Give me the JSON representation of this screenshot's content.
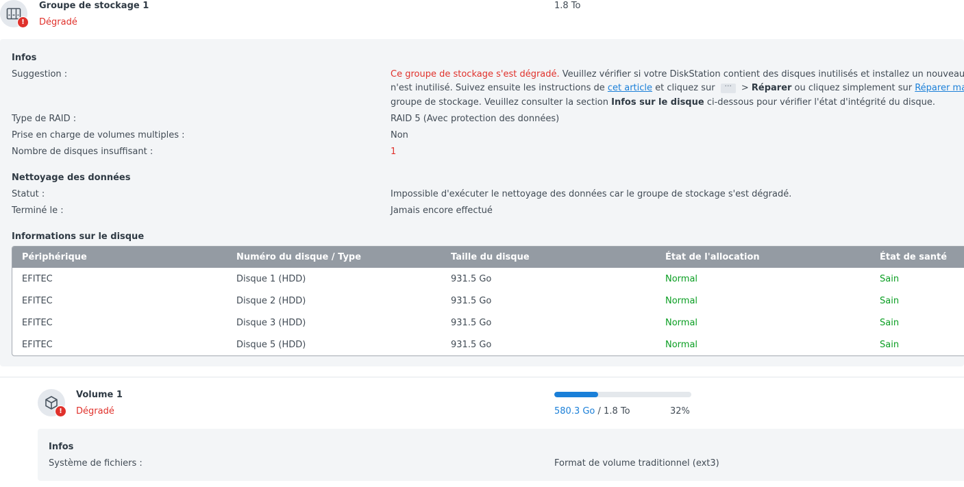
{
  "pool": {
    "name": "Groupe de stockage 1",
    "status": "Dégradé",
    "capacity": "1.8 To",
    "icon": "storage-pool-icon",
    "alert_icon": "alert-icon",
    "alert_symbol": "!"
  },
  "info": {
    "title": "Infos",
    "suggestion_label": "Suggestion :",
    "suggestion": {
      "red_part": "Ce groupe de stockage s'est dégradé.",
      "line1_rest": " Veuillez vérifier si votre DiskStation contient des disques inutilisés et installez un nouveau",
      "line2_a": "n'est inutilisé. Suivez ensuite les instructions de ",
      "link_article": "cet article",
      "line2_b": " et cliquez sur ",
      "more_glyph": "···",
      "line2_c": " > ",
      "repair_bold": "Réparer",
      "line2_d": " ou cliquez simplement sur ",
      "link_repair": "Réparer ma",
      "line3_a": "groupe de stockage. Veuillez consulter la section ",
      "disk_info_bold": "Infos sur le disque",
      "line3_b": " ci-dessous pour vérifier l'état d'intégrité du disque."
    },
    "raid_label": "Type de RAID :",
    "raid_value": "RAID 5 (Avec protection des données)",
    "multi_label": "Prise en charge de volumes multiples :",
    "multi_value": "Non",
    "missing_label": "Nombre de disques insuffisant :",
    "missing_value": "1"
  },
  "scrub": {
    "title": "Nettoyage des données",
    "status_label": "Statut :",
    "status_value": "Impossible d'exécuter le nettoyage des données car le groupe de stockage s'est dégradé.",
    "done_label": "Terminé le :",
    "done_value": "Jamais encore effectué"
  },
  "disks": {
    "title": "Informations sur le disque",
    "columns": [
      "Périphérique",
      "Numéro du disque / Type",
      "Taille du disque",
      "État de l'allocation",
      "État de santé"
    ],
    "rows": [
      [
        "EFITEC",
        "Disque 1 (HDD)",
        "931.5 Go",
        "Normal",
        "Sain"
      ],
      [
        "EFITEC",
        "Disque 2 (HDD)",
        "931.5 Go",
        "Normal",
        "Sain"
      ],
      [
        "EFITEC",
        "Disque 3 (HDD)",
        "931.5 Go",
        "Normal",
        "Sain"
      ],
      [
        "EFITEC",
        "Disque 5 (HDD)",
        "931.5 Go",
        "Normal",
        "Sain"
      ]
    ]
  },
  "volume": {
    "name": "Volume 1",
    "status": "Dégradé",
    "icon": "volume-cube-icon",
    "used": "580.3 Go",
    "separator": " / ",
    "total": "1.8 To",
    "percent_label": "32%",
    "percent": 32,
    "info_title": "Infos",
    "fs_label": "Système de fichiers :",
    "fs_value": "Format de volume traditionnel (ext3)"
  },
  "colors": {
    "danger": "#e0312b",
    "ok": "#0a9e22",
    "accent": "#1a7fd8",
    "table_header": "#949ba3",
    "panel_bg": "#f3f5f7"
  }
}
